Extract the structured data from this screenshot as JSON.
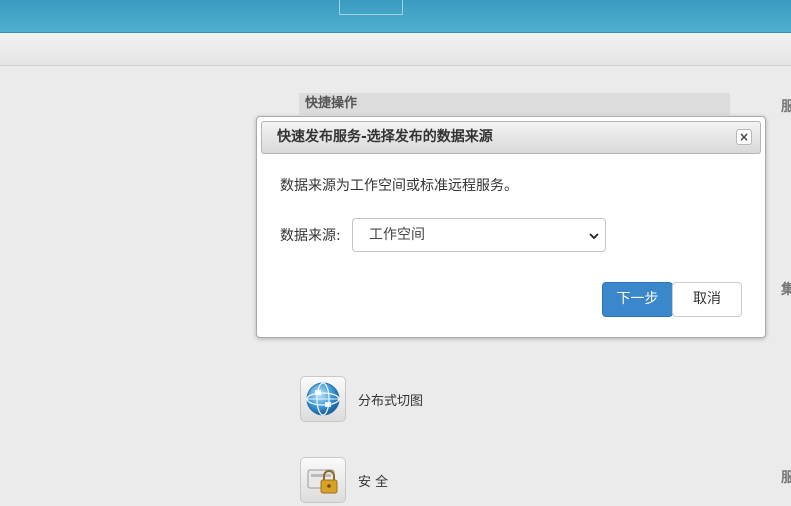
{
  "quick_ops": {
    "title": "快捷操作"
  },
  "right_labels": [
    "服",
    "集",
    "服"
  ],
  "dialog": {
    "title": "快速发布服务-选择发布的数据来源",
    "close_glyph": "×",
    "description": "数据来源为工作空间或标准远程服务。",
    "source_label": "数据来源:",
    "source_value": "工作空间",
    "next_label": "下一步",
    "cancel_label": "取消"
  },
  "tools": [
    {
      "label": "分布式切图",
      "icon": "globe-icon"
    },
    {
      "label": "安 全",
      "icon": "lock-icon"
    }
  ],
  "colors": {
    "topbar": "#4aa9cb",
    "primary_button": "#3b87cc"
  }
}
